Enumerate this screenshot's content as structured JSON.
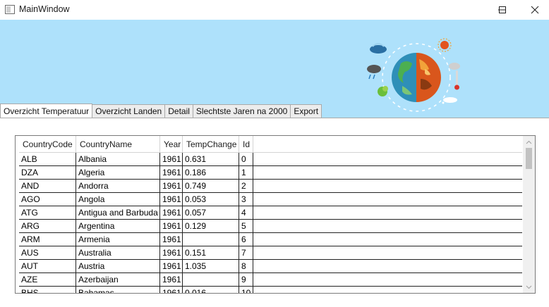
{
  "window": {
    "title": "MainWindow"
  },
  "caption": {
    "minimize": "minimize-icon",
    "maximize": "maximize-icon",
    "close": "close-icon"
  },
  "tabs": [
    {
      "label": "Overzicht Temperatuur",
      "active": true
    },
    {
      "label": "Overzicht Landen",
      "active": false
    },
    {
      "label": "Detail",
      "active": false
    },
    {
      "label": "Slechtste Jaren na 2000",
      "active": false
    },
    {
      "label": "Export",
      "active": false
    }
  ],
  "grid": {
    "columns": [
      "CountryCode",
      "CountryName",
      "Year",
      "TempChange",
      "Id"
    ],
    "rows": [
      [
        "ALB",
        "Albania",
        "1961",
        "0.631",
        "0"
      ],
      [
        "DZA",
        "Algeria",
        "1961",
        "0.186",
        "1"
      ],
      [
        "AND",
        "Andorra",
        "1961",
        "0.749",
        "2"
      ],
      [
        "AGO",
        "Angola",
        "1961",
        "0.053",
        "3"
      ],
      [
        "ATG",
        "Antigua and Barbuda",
        "1961",
        "0.057",
        "4"
      ],
      [
        "ARG",
        "Argentina",
        "1961",
        "0.129",
        "5"
      ],
      [
        "ARM",
        "Armenia",
        "1961",
        "",
        "6"
      ],
      [
        "AUS",
        "Australia",
        "1961",
        "0.151",
        "7"
      ],
      [
        "AUT",
        "Austria",
        "1961",
        "1.035",
        "8"
      ],
      [
        "AZE",
        "Azerbaijan",
        "1961",
        "",
        "9"
      ],
      [
        "BHS",
        "Bahamas",
        "1961",
        "0.016",
        "10"
      ]
    ]
  },
  "colors": {
    "header_band": "#aee1fb",
    "titlebar": "#ffffff"
  }
}
